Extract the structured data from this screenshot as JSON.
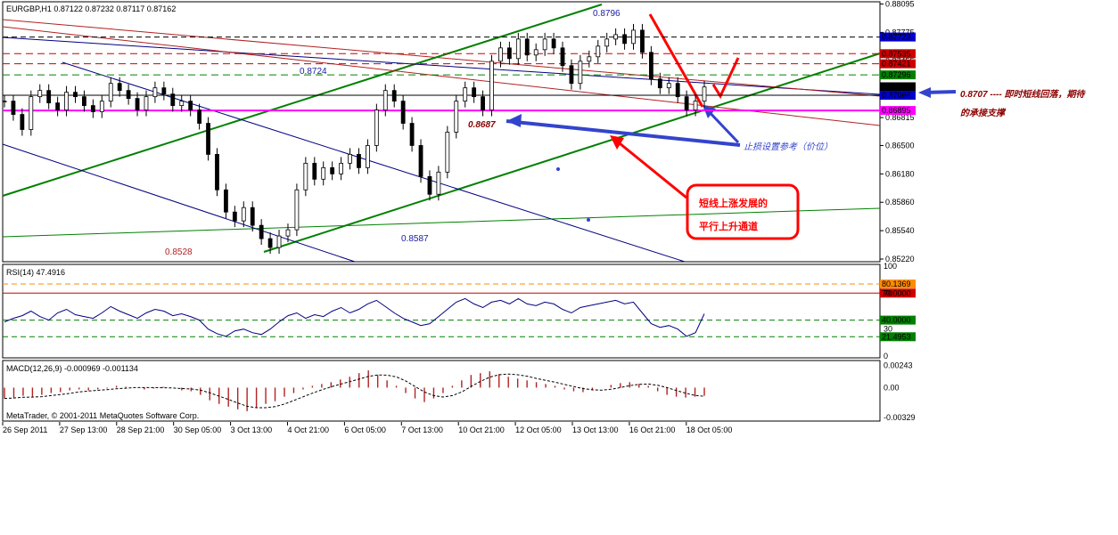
{
  "chart_data": {
    "type": "candlestick",
    "symbol_header": "EURGBP,H1  0.87122 0.87232 0.87117 0.87162",
    "price_ticks": [
      "0.88095",
      "0.87775",
      "0.87455",
      "0.87130",
      "0.86815",
      "0.86500",
      "0.86180",
      "0.85860",
      "0.85540",
      "0.85220"
    ],
    "price_tick_values": [
      0.88095,
      0.87775,
      0.87455,
      0.8713,
      0.86815,
      0.865,
      0.8618,
      0.8586,
      0.8554,
      0.8522
    ],
    "price_ylim": [
      0.8521,
      0.881
    ],
    "price_boxes": [
      {
        "text": "0.87723",
        "value": 0.87723,
        "color": "#0000cc"
      },
      {
        "text": "0.87535",
        "value": 0.87535,
        "color": "#cc0000"
      },
      {
        "text": "0.87421",
        "value": 0.87421,
        "color": "#cc0000"
      },
      {
        "text": "0.87296",
        "value": 0.87296,
        "color": "#008000"
      },
      {
        "text": "0.87162",
        "value": 0.87162,
        "color": "#000000"
      },
      {
        "text": "0.87066",
        "value": 0.87066,
        "color": "#0000cc"
      },
      {
        "text": "0.86895",
        "value": 0.86895,
        "color": "#ff00ff"
      }
    ],
    "chart_labels": [
      {
        "text": "0.8796",
        "value": 0.8796,
        "color": "#1a1aa6"
      },
      {
        "text": "0.8724",
        "value": 0.8724,
        "color": "#1a1aa6"
      },
      {
        "text": "0.8687",
        "value": 0.8687,
        "color": "#8b0000"
      },
      {
        "text": "0.8587",
        "value": 0.8587,
        "color": "#1a1aa6"
      },
      {
        "text": "0.8528",
        "value": 0.8528,
        "color": "#b22222"
      }
    ],
    "approx_close_path": [
      0.87,
      0.8685,
      0.8668,
      0.8705,
      0.8712,
      0.8698,
      0.869,
      0.871,
      0.8705,
      0.8695,
      0.8688,
      0.87,
      0.872,
      0.8712,
      0.8703,
      0.869,
      0.8705,
      0.8715,
      0.8708,
      0.8695,
      0.87,
      0.869,
      0.8675,
      0.864,
      0.86,
      0.8575,
      0.8565,
      0.858,
      0.856,
      0.8545,
      0.8535,
      0.8548,
      0.8555,
      0.86,
      0.863,
      0.8612,
      0.8625,
      0.8618,
      0.863,
      0.864,
      0.8625,
      0.865,
      0.869,
      0.8712,
      0.87,
      0.8675,
      0.865,
      0.8615,
      0.8595,
      0.862,
      0.8665,
      0.87,
      0.8715,
      0.8705,
      0.869,
      0.8745,
      0.876,
      0.8748,
      0.877,
      0.8752,
      0.8758,
      0.877,
      0.876,
      0.874,
      0.872,
      0.8745,
      0.875,
      0.8762,
      0.877,
      0.8775,
      0.8765,
      0.878,
      0.8755,
      0.8725,
      0.8715,
      0.872,
      0.8705,
      0.869,
      0.87,
      0.8716
    ],
    "rsi": {
      "label": "RSI(14) 47.4916",
      "ticks": [
        "100",
        "70",
        "30",
        "0"
      ],
      "tick_values": [
        100,
        70,
        30,
        0
      ],
      "boxes": [
        {
          "text": "80.1369",
          "value": 80.1369,
          "color": "#ff8c00"
        },
        {
          "text": "70.0000",
          "value": 70,
          "color": "#cc0000"
        },
        {
          "text": "40.0000",
          "value": 40,
          "color": "#008000"
        },
        {
          "text": "21.4953",
          "value": 21.4953,
          "color": "#008000"
        }
      ],
      "approx_values": [
        38,
        42,
        45,
        50,
        44,
        40,
        48,
        52,
        46,
        44,
        42,
        48,
        55,
        50,
        46,
        42,
        48,
        52,
        50,
        45,
        47,
        44,
        40,
        30,
        25,
        22,
        28,
        30,
        26,
        24,
        30,
        38,
        45,
        48,
        42,
        46,
        44,
        50,
        54,
        48,
        52,
        58,
        62,
        55,
        48,
        42,
        38,
        34,
        36,
        44,
        52,
        60,
        64,
        58,
        54,
        60,
        62,
        58,
        64,
        58,
        56,
        60,
        58,
        52,
        48,
        54,
        56,
        58,
        60,
        62,
        58,
        60,
        48,
        36,
        32,
        34,
        30,
        22,
        26,
        47
      ]
    },
    "macd": {
      "label": "MACD(12,26,9) -0.000969 -0.001134",
      "ticks": [
        "0.00243",
        "0.00",
        "-0.00329"
      ],
      "tick_values": [
        0.00243,
        0,
        -0.00329
      ],
      "approx_values": [
        -0.0012,
        -0.0011,
        -0.0009,
        -0.001,
        -0.0008,
        -0.0006,
        -0.0005,
        -0.0003,
        -0.0002,
        -0.0003,
        -0.0002,
        -0.0001,
        0.0002,
        0.0001,
        0.0,
        -0.0002,
        -0.0001,
        0.0001,
        0.0,
        -0.0003,
        -0.0004,
        -0.0008,
        -0.0014,
        -0.0018,
        -0.0021,
        -0.0024,
        -0.0026,
        -0.0022,
        -0.0018,
        -0.0015,
        -0.001,
        -0.0006,
        -0.0002,
        0.0002,
        0.0004,
        0.0006,
        0.0009,
        0.0012,
        0.0016,
        0.0019,
        0.0014,
        0.0008,
        0.0002,
        -0.0006,
        -0.0012,
        -0.0016,
        -0.0012,
        -0.0006,
        0.0002,
        0.0008,
        0.0014,
        0.0016,
        0.0018,
        0.0015,
        0.0012,
        0.001,
        0.0008,
        0.0006,
        0.0004,
        0.0002,
        -0.0002,
        -0.0004,
        -0.0005,
        -0.0003,
        0.0,
        0.0003,
        0.0005,
        0.0006,
        0.0004,
        0.0002,
        -0.0004,
        -0.0008,
        -0.001,
        -0.0011,
        -0.001,
        -0.0009
      ]
    },
    "x_ticks": [
      "26 Sep 2011",
      "27 Sep 13:00",
      "28 Sep 21:00",
      "30 Sep 05:00",
      "3 Oct 13:00",
      "4 Oct 21:00",
      "6 Oct 05:00",
      "7 Oct 13:00",
      "10 Oct 21:00",
      "12 Oct 05:00",
      "13 Oct 13:00",
      "16 Oct 21:00",
      "18 Oct 05:00"
    ],
    "copyright": "MetaTrader, © 2001-2011 MetaQuotes Software Corp.",
    "annotations": {
      "support_value": "0.8707",
      "support_text_1": " ---- 即时短线回落，期待",
      "support_text_2": "的承接支撑",
      "stop_text": "止损设置参考（价位）",
      "channel_line1": "短线上涨发展的",
      "channel_line2": "平行上升通道"
    },
    "colors": {
      "up_candle": "#000000",
      "channel_green": "#008000",
      "channel_blue": "#000080",
      "resistance_red": "#b22222",
      "magenta": "#ff00ff",
      "note_blue": "#3344cc",
      "note_red": "#ff0000"
    }
  }
}
